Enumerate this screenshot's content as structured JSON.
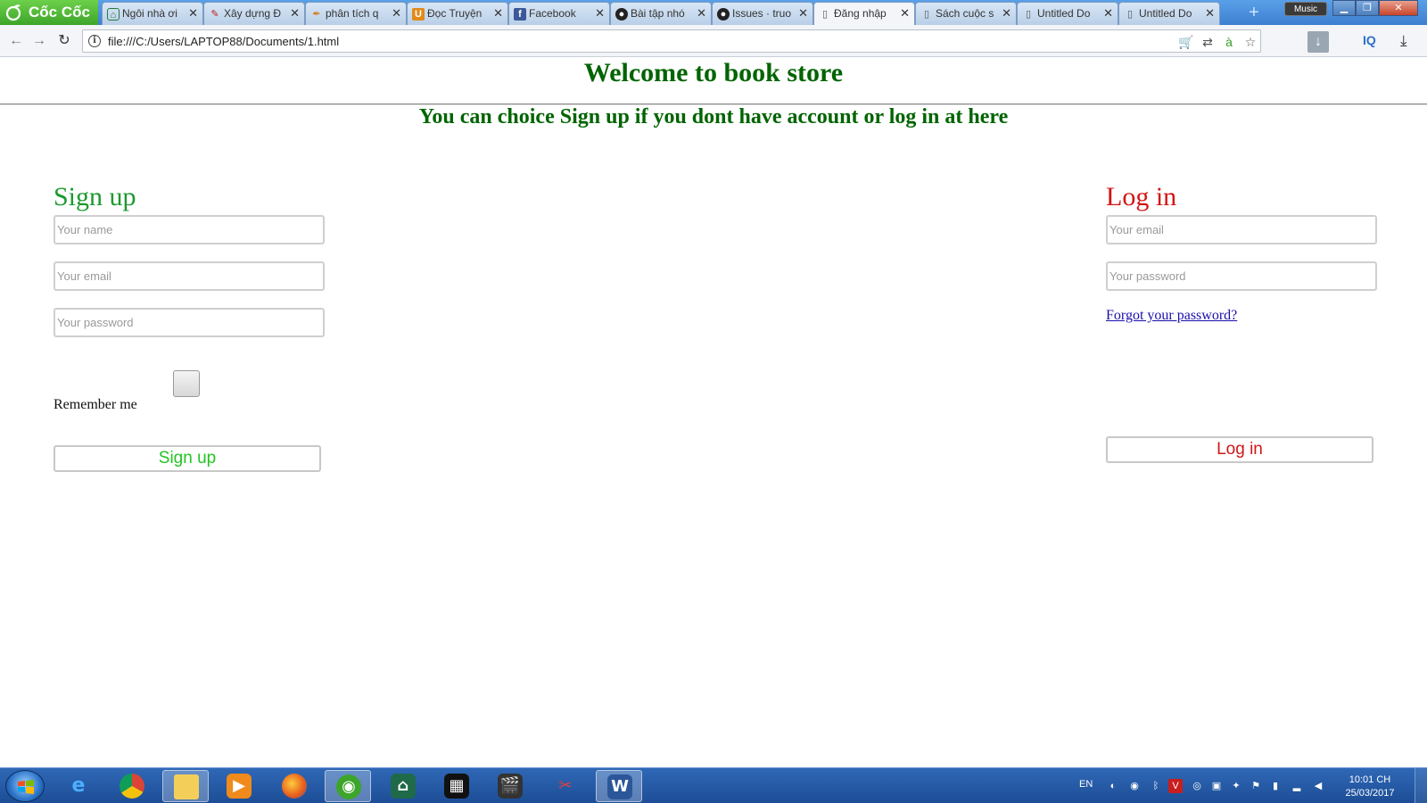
{
  "browser": {
    "brand": "Cốc Cốc",
    "tabs": [
      {
        "label": "Ngôi nhà ơi",
        "icon": "house-icon"
      },
      {
        "label": "Xây dựng Đ",
        "icon": "pen-icon"
      },
      {
        "label": "phân tích q",
        "icon": "quill-icon"
      },
      {
        "label": "Đọc Truyện",
        "icon": "book-icon"
      },
      {
        "label": "Facebook",
        "icon": "facebook-icon"
      },
      {
        "label": "Bài tập nhó",
        "icon": "github-icon"
      },
      {
        "label": "Issues · truo",
        "icon": "github-icon"
      },
      {
        "label": "Đăng nhập",
        "icon": "document-icon"
      },
      {
        "label": "Sách cuộc s",
        "icon": "document-icon"
      },
      {
        "label": "Untitled Do",
        "icon": "document-icon"
      },
      {
        "label": "Untitled Do",
        "icon": "document-icon"
      }
    ],
    "active_tab_index": 7,
    "music_label": "Music",
    "url": "file:///C:/Users/LAPTOP88/Documents/1.html",
    "iq_label": "IQ",
    "colors": {
      "tabstrip": "#3d7fd0",
      "brand": "#3da52a"
    }
  },
  "page": {
    "welcome": "Welcome to book store",
    "subtitle": "You can choice Sign up if you dont have account or log in at here",
    "signup": {
      "title": "Sign up",
      "name_placeholder": "Your name",
      "email_placeholder": "Your email",
      "password_placeholder": "Your password",
      "remember_label": "Remember me",
      "button_label": "Sign up"
    },
    "login": {
      "title": "Log in",
      "email_placeholder": "Your email",
      "password_placeholder": "Your password",
      "forgot_label": "Forgot your password?",
      "button_label": "Log in"
    },
    "colors": {
      "heading_green": "#006400",
      "signup_green": "#1a9a2e",
      "signup_button_green": "#22c522",
      "login_red": "#d21515",
      "link_blue": "#1a0dab"
    }
  },
  "taskbar": {
    "apps": [
      "internet-explorer-icon",
      "chrome-icon",
      "file-explorer-icon",
      "media-player-icon",
      "firefox-icon",
      "coccoc-icon",
      "house-app-icon",
      "film-icon",
      "clapper-icon",
      "snipping-tool-icon",
      "word-icon"
    ],
    "tray_language": "EN",
    "time": "10:01 CH",
    "date": "25/03/2017"
  }
}
